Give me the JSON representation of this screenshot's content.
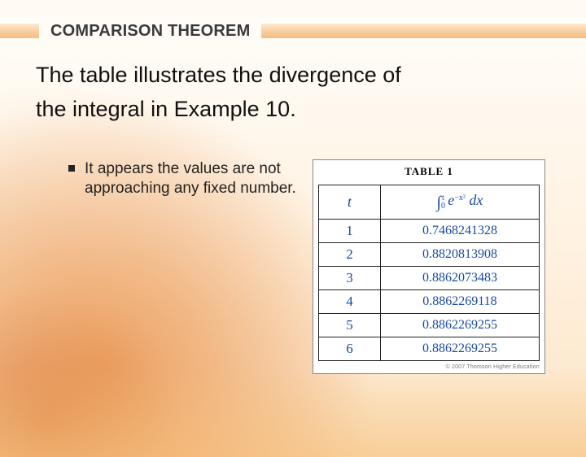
{
  "header": {
    "title": "COMPARISON THEOREM"
  },
  "body": {
    "line1": "The table illustrates the divergence of",
    "line2": "the integral in Example 10."
  },
  "bullet": {
    "text": "It appears the values are not approaching any fixed number."
  },
  "table": {
    "caption": "TABLE 1",
    "col_t_label": "t",
    "integral_html": "∫₀ᵗ e^(−x²) dx",
    "copyright": "© 2007 Thomson Higher Education"
  },
  "chart_data": {
    "type": "table",
    "title": "TABLE 1",
    "columns": [
      "t",
      "∫_0^t e^{-x^2} dx"
    ],
    "rows": [
      {
        "t": 1,
        "value": 0.7468241328
      },
      {
        "t": 2,
        "value": 0.8820813908
      },
      {
        "t": 3,
        "value": 0.8862073483
      },
      {
        "t": 4,
        "value": 0.8862269118
      },
      {
        "t": 5,
        "value": 0.8862269255
      },
      {
        "t": 6,
        "value": 0.8862269255
      }
    ]
  }
}
